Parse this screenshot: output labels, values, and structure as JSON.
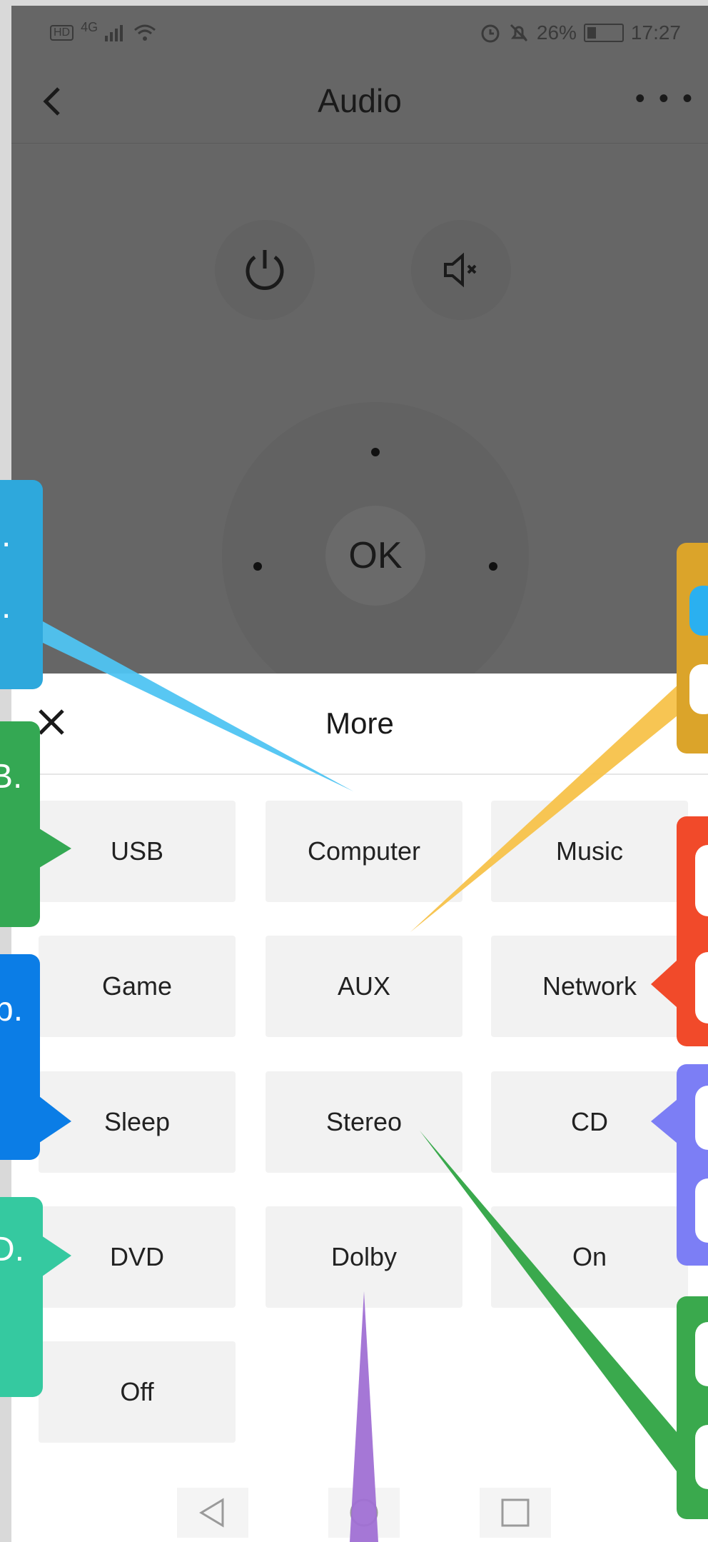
{
  "status_bar": {
    "left_chip": "HD",
    "signal": "4G",
    "battery_percent": "26%",
    "time": "17:27"
  },
  "header": {
    "title": "Audio"
  },
  "remote": {
    "ok_label": "OK"
  },
  "sheet": {
    "title": "More",
    "buttons": [
      "USB",
      "Computer",
      "Music",
      "Game",
      "AUX",
      "Network",
      "Sleep",
      "Stereo",
      "CD",
      "DVD",
      "Dolby",
      "On",
      "Off"
    ]
  },
  "callouts": {
    "left": [
      ".",
      ".",
      "B.",
      "p.",
      "D."
    ],
    "colors": {
      "cyan": "#2ea8dc",
      "green": "#34a853",
      "blue": "#0b7de6",
      "teal": "#35c9a0",
      "gold": "#dba42a",
      "red": "#f14a2a",
      "periwinkle": "#7c7ef5",
      "purple": "#a070d4",
      "dark_green": "#3aa94d"
    }
  }
}
